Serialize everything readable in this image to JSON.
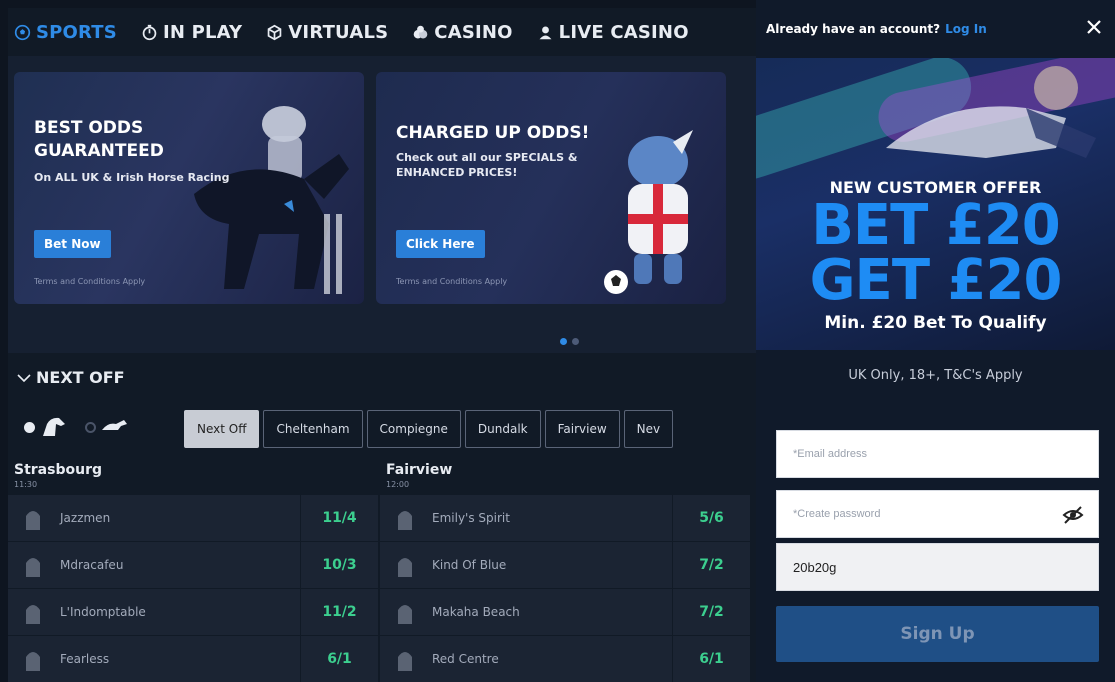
{
  "nav": {
    "items": [
      {
        "label": "SPORTS",
        "icon": "soccer-ball-icon",
        "active": true
      },
      {
        "label": "IN PLAY",
        "icon": "stopwatch-icon",
        "active": false
      },
      {
        "label": "VIRTUALS",
        "icon": "cube-icon",
        "active": false
      },
      {
        "label": "CASINO",
        "icon": "chips-icon",
        "active": false
      },
      {
        "label": "LIVE CASINO",
        "icon": "dealer-icon",
        "active": false
      }
    ]
  },
  "promos": [
    {
      "title": "BEST ODDS GUARANTEED",
      "subtitle": "On ALL UK & Irish Horse Racing",
      "button": "Bet Now",
      "terms": "Terms and Conditions Apply"
    },
    {
      "title": "CHARGED UP ODDS!",
      "subtitle": "Check out all our SPECIALS & ENHANCED PRICES!",
      "button": "Click Here",
      "terms": "Terms and Conditions Apply"
    }
  ],
  "next_off": {
    "header": "NEXT OFF",
    "tabs": [
      "Next Off",
      "Cheltenham",
      "Compiegne",
      "Dundalk",
      "Fairview",
      "Nev"
    ],
    "meetings": [
      {
        "name": "Strasbourg",
        "time": "11:30",
        "runners": [
          {
            "name": "Jazzmen",
            "odds": "11/4"
          },
          {
            "name": "Mdracafeu",
            "odds": "10/3"
          },
          {
            "name": "L'Indomptable",
            "odds": "11/2"
          },
          {
            "name": "Fearless",
            "odds": "6/1"
          }
        ]
      },
      {
        "name": "Fairview",
        "time": "12:00",
        "runners": [
          {
            "name": "Emily's Spirit",
            "odds": "5/6"
          },
          {
            "name": "Kind Of Blue",
            "odds": "7/2"
          },
          {
            "name": "Makaha Beach",
            "odds": "7/2"
          },
          {
            "name": "Red Centre",
            "odds": "6/1"
          }
        ]
      }
    ]
  },
  "signup": {
    "header_text": "Already have an account?",
    "login_link": "Log In",
    "offer_label": "NEW CUSTOMER OFFER",
    "offer_line1": "BET £20",
    "offer_line2": "GET £20",
    "offer_min": "Min. £20 Bet To Qualify",
    "offer_terms": "UK Only, 18+, T&C's Apply",
    "email_placeholder": "*Email address",
    "password_placeholder": "*Create password",
    "promo_code_value": "20b20g",
    "submit_label": "Sign Up"
  },
  "colors": {
    "accent": "#2f8be6",
    "odds": "#3ccf8f",
    "panel_bg": "#101a2a",
    "signup_button": "#1f4f86"
  }
}
